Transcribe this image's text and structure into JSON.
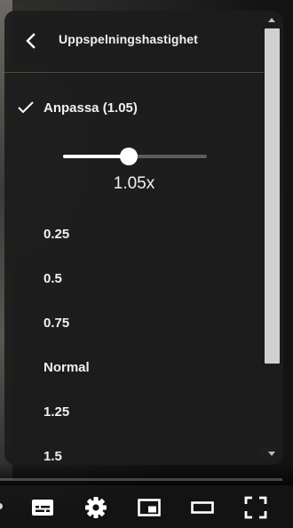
{
  "settings_panel": {
    "title": "Uppspelningshastighet",
    "custom_option_label": "Anpassa (1.05)",
    "slider": {
      "min": 0.25,
      "max": 2,
      "value": 1.05,
      "display": "1.05x"
    },
    "speed_options": [
      "0.25",
      "0.5",
      "0.75",
      "Normal",
      "1.25",
      "1.5"
    ]
  },
  "player_controls": {
    "icons": [
      "subtitles-icon",
      "settings-gear-icon",
      "miniplayer-icon",
      "theater-mode-icon",
      "fullscreen-icon"
    ]
  },
  "colors": {
    "panel_bg": "#1c1c1c",
    "text": "#f1f1f1",
    "slider_track": "#5c5c5c",
    "slider_fill": "#ffffff"
  }
}
